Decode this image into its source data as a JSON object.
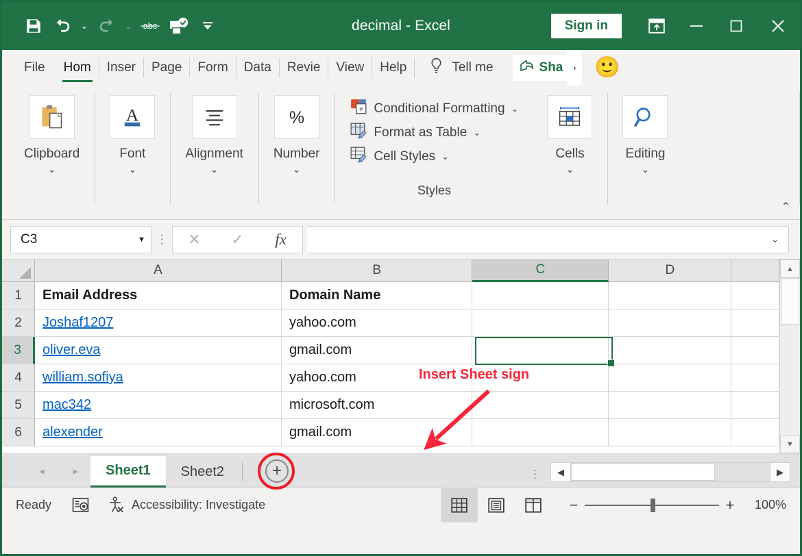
{
  "titlebar": {
    "document_title": "decimal - Excel",
    "signin_label": "Sign in",
    "qat": [
      {
        "name": "save-icon",
        "label": "Save"
      },
      {
        "name": "undo-icon",
        "label": "Undo"
      },
      {
        "name": "redo-icon",
        "label": "Redo"
      },
      {
        "name": "spelling-icon",
        "label": "abc"
      },
      {
        "name": "print-preview-icon",
        "label": "Print Preview and Print"
      },
      {
        "name": "customize-quick-access-toolbar-icon",
        "label": "Customize Quick Access Toolbar"
      }
    ],
    "window_controls": [
      {
        "name": "ribbon-display-options-icon",
        "label": "Ribbon Display Options"
      },
      {
        "name": "minimize-icon",
        "label": "Minimize"
      },
      {
        "name": "maximize-icon",
        "label": "Maximize"
      },
      {
        "name": "close-icon",
        "label": "Close"
      }
    ]
  },
  "ribbon_tabs": {
    "file": "File",
    "tabs": [
      {
        "label": "Hom",
        "active": true
      },
      {
        "label": "Inser",
        "active": false
      },
      {
        "label": "Page",
        "active": false
      },
      {
        "label": "Form",
        "active": false
      },
      {
        "label": "Data",
        "active": false
      },
      {
        "label": "Revie",
        "active": false
      },
      {
        "label": "View",
        "active": false
      },
      {
        "label": "Help",
        "active": false
      }
    ],
    "tell_me": "Tell me",
    "share": "Sha",
    "smiley": "🙂"
  },
  "ribbon": {
    "groups": [
      {
        "label": "Clipboard",
        "icon": "clipboard-icon"
      },
      {
        "label": "Font",
        "icon": "font-icon"
      },
      {
        "label": "Alignment",
        "icon": "alignment-icon"
      },
      {
        "label": "Number",
        "icon": "percent-icon"
      }
    ],
    "styles": {
      "caption": "Styles",
      "items": [
        {
          "label": "Conditional Formatting",
          "caret": "⌄"
        },
        {
          "label": "Format as Table",
          "caret": "⌄"
        },
        {
          "label": "Cell Styles",
          "caret": "⌄"
        }
      ]
    },
    "groups_right": [
      {
        "label": "Cells",
        "icon": "cells-icon"
      },
      {
        "label": "Editing",
        "icon": "find-select-icon"
      }
    ],
    "chevron": "⌄",
    "collapse": "⌃"
  },
  "formula_bar": {
    "name_box_value": "C3",
    "name_box_caret": "▼",
    "cancel": "✕",
    "enter": "✓",
    "fx": "fx",
    "formula_value": "",
    "expand_caret": "⌄"
  },
  "grid": {
    "columns": [
      "A",
      "B",
      "C",
      "D"
    ],
    "selected_column": "C",
    "selected_row": 3,
    "selected_cell": "C3",
    "rows": [
      {
        "num": "1",
        "a": "Email Address",
        "b": "Domain Name",
        "c": "",
        "d": "",
        "style": "bold"
      },
      {
        "num": "2",
        "a": "Joshaf1207",
        "b": "yahoo.com",
        "c": "",
        "d": "",
        "style": "link"
      },
      {
        "num": "3",
        "a": "oliver.eva",
        "b": "gmail.com",
        "c": "",
        "d": "",
        "style": "link"
      },
      {
        "num": "4",
        "a": "william.sofiya",
        "b": "yahoo.com",
        "c": "",
        "d": "",
        "style": "link"
      },
      {
        "num": "5",
        "a": "mac342",
        "b": "microsoft.com",
        "c": "",
        "d": "",
        "style": "link"
      },
      {
        "num": "6",
        "a": "alexender",
        "b": "gmail.com",
        "c": "",
        "d": "",
        "style": "link"
      }
    ]
  },
  "annotation": {
    "text": "Insert Sheet sign",
    "color": "#f8253a"
  },
  "sheet_tabs": {
    "prev": "◂",
    "next": "▸",
    "tabs": [
      {
        "label": "Sheet1",
        "active": true
      },
      {
        "label": "Sheet2",
        "active": false
      }
    ],
    "add_sheet": "+"
  },
  "scrollbars": {
    "v_up": "▲",
    "v_down": "▼",
    "h_left": "◀",
    "h_right": "▶"
  },
  "statusbar": {
    "mode": "Ready",
    "macro_icon": "record-macro-icon",
    "accessibility": "Accessibility: Investigate",
    "views": [
      {
        "name": "normal-view-button",
        "active": true
      },
      {
        "name": "page-layout-view-button",
        "active": false
      },
      {
        "name": "page-break-preview-button",
        "active": false
      }
    ],
    "zoom_out": "−",
    "zoom_in": "+",
    "zoom_level": "100%"
  },
  "colors": {
    "brand_green": "#217346",
    "link_blue": "#0563c1",
    "annotation_red": "#f8253a"
  }
}
